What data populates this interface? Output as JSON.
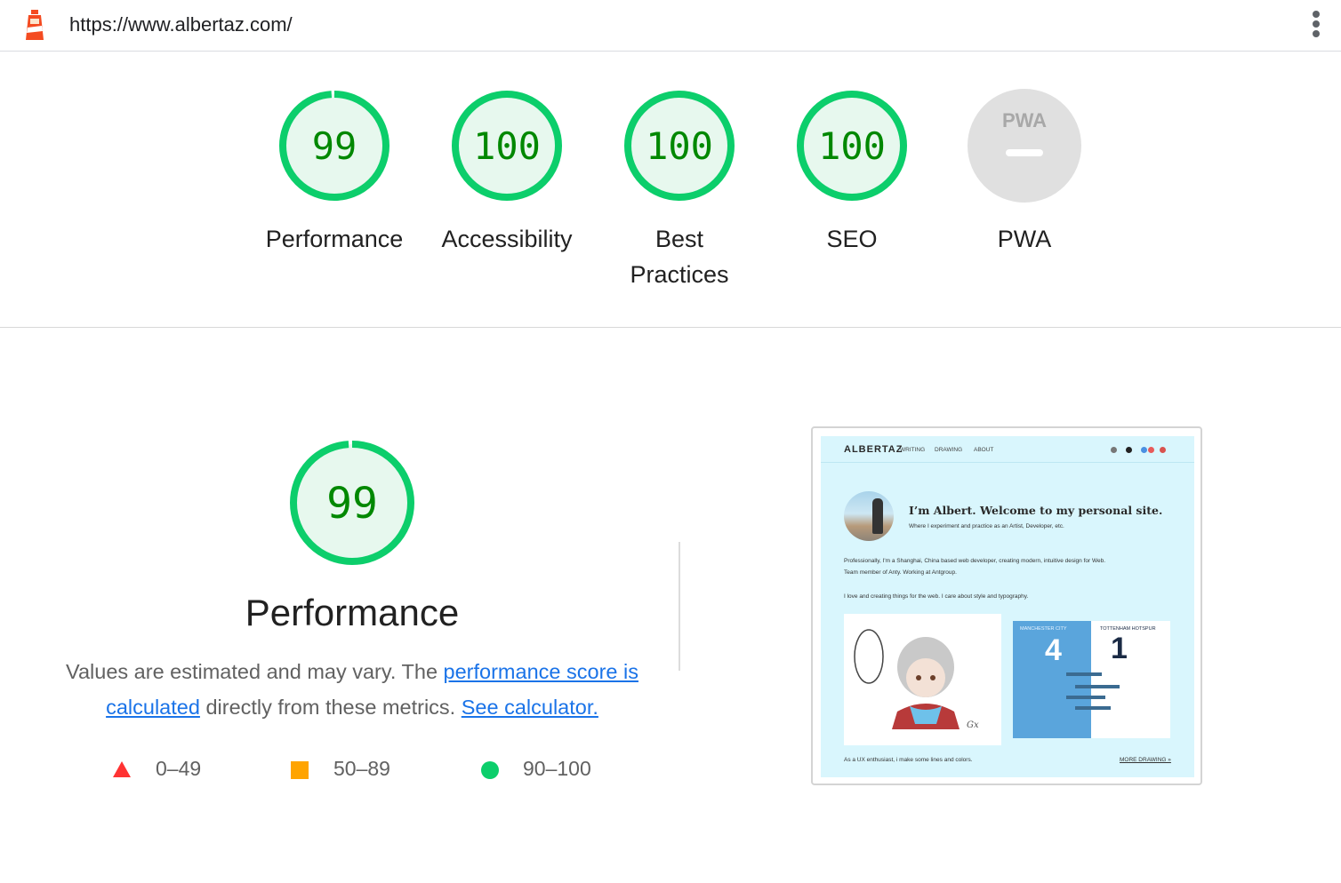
{
  "browser": {
    "url": "https://www.albertaz.com/",
    "icons": {
      "logo": "lighthouse-icon",
      "menu": "more-vert-icon"
    }
  },
  "colors": {
    "pass": "#0cce6b",
    "pass_text": "#008800",
    "pass_fill": "#e7f8ee",
    "average": "#ffa400",
    "fail": "#ff3333",
    "link": "#1a73e8",
    "na_fill": "#e0e0e0"
  },
  "categories": [
    {
      "label": "Performance",
      "score": "99",
      "value": 99
    },
    {
      "label": "Accessibility",
      "score": "100",
      "value": 100
    },
    {
      "label_line1": "Best",
      "label_line2": "Practices",
      "score": "100",
      "value": 100
    },
    {
      "label": "SEO",
      "score": "100",
      "value": 100
    },
    {
      "label": "PWA",
      "badge": "PWA",
      "score_text": "—"
    }
  ],
  "performance": {
    "score": "99",
    "value": 99,
    "title": "Performance",
    "desc_prefix": "Values are estimated and may vary. The ",
    "link1": "performance score is calculated",
    "desc_middle": " directly from these metrics. ",
    "link2": "See calculator.",
    "legend": [
      {
        "shape": "triangle",
        "label": "0–49"
      },
      {
        "shape": "square",
        "label": "50–89"
      },
      {
        "shape": "circle",
        "label": "90–100"
      }
    ]
  },
  "thumbnail": {
    "brand": "ALBERTAZ",
    "nav": [
      "WRITING",
      "DRAWING",
      "ABOUT"
    ],
    "headline": "I’m Albert. Welcome to my personal site.",
    "subline": "Where I experiment and practice as an Artist, Developer, etc.",
    "para1": "Professionally, I'm a Shanghai, China based web developer, creating modern, intuitive design for Web.",
    "para2": "Team member of Anty. Working at Antgroup.",
    "para3": "I love and creating things for the web. I care about style and typography.",
    "team_left": "MANCHESTER CITY",
    "team_right": "TOTTENHAM HOTSPUR",
    "score_left": "4",
    "score_right": "1",
    "footer": "As a UX enthusiast, i make some lines and colors.",
    "more": "MORE DRAWING »"
  }
}
